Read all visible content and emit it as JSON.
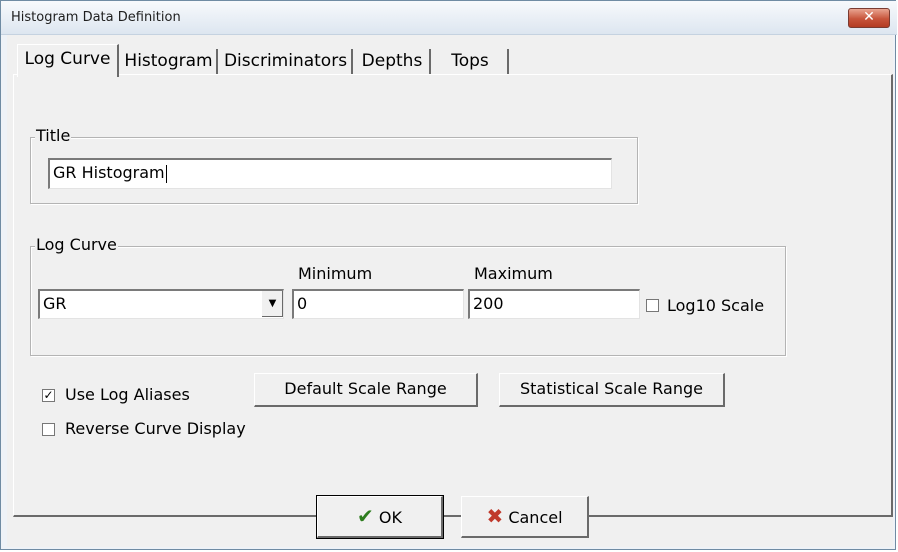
{
  "window": {
    "title": "Histogram Data Definition",
    "close_symbol": "✕"
  },
  "tabs": [
    {
      "label": "Log Curve",
      "active": true
    },
    {
      "label": "Histogram",
      "active": false
    },
    {
      "label": "Discriminators",
      "active": false
    },
    {
      "label": "Depths",
      "active": false
    },
    {
      "label": "Tops",
      "active": false
    }
  ],
  "title_group": {
    "label": "Title",
    "value": "GR Histogram"
  },
  "log_curve_group": {
    "label": "Log Curve",
    "curve_value": "GR",
    "minimum_label": "Minimum",
    "minimum_value": "0",
    "maximum_label": "Maximum",
    "maximum_value": "200",
    "log10_label": "Log10 Scale",
    "log10_checked": false
  },
  "options": {
    "use_aliases_label": "Use Log Aliases",
    "use_aliases_checked": true,
    "reverse_label": "Reverse Curve Display",
    "reverse_checked": false
  },
  "buttons": {
    "default_scale": "Default Scale Range",
    "statistical_scale": "Statistical Scale Range",
    "ok": "OK",
    "cancel": "Cancel"
  },
  "glyphs": {
    "check": "✔",
    "cancel_x": "✖",
    "dropdown": "▼",
    "checkmark": "✓"
  }
}
